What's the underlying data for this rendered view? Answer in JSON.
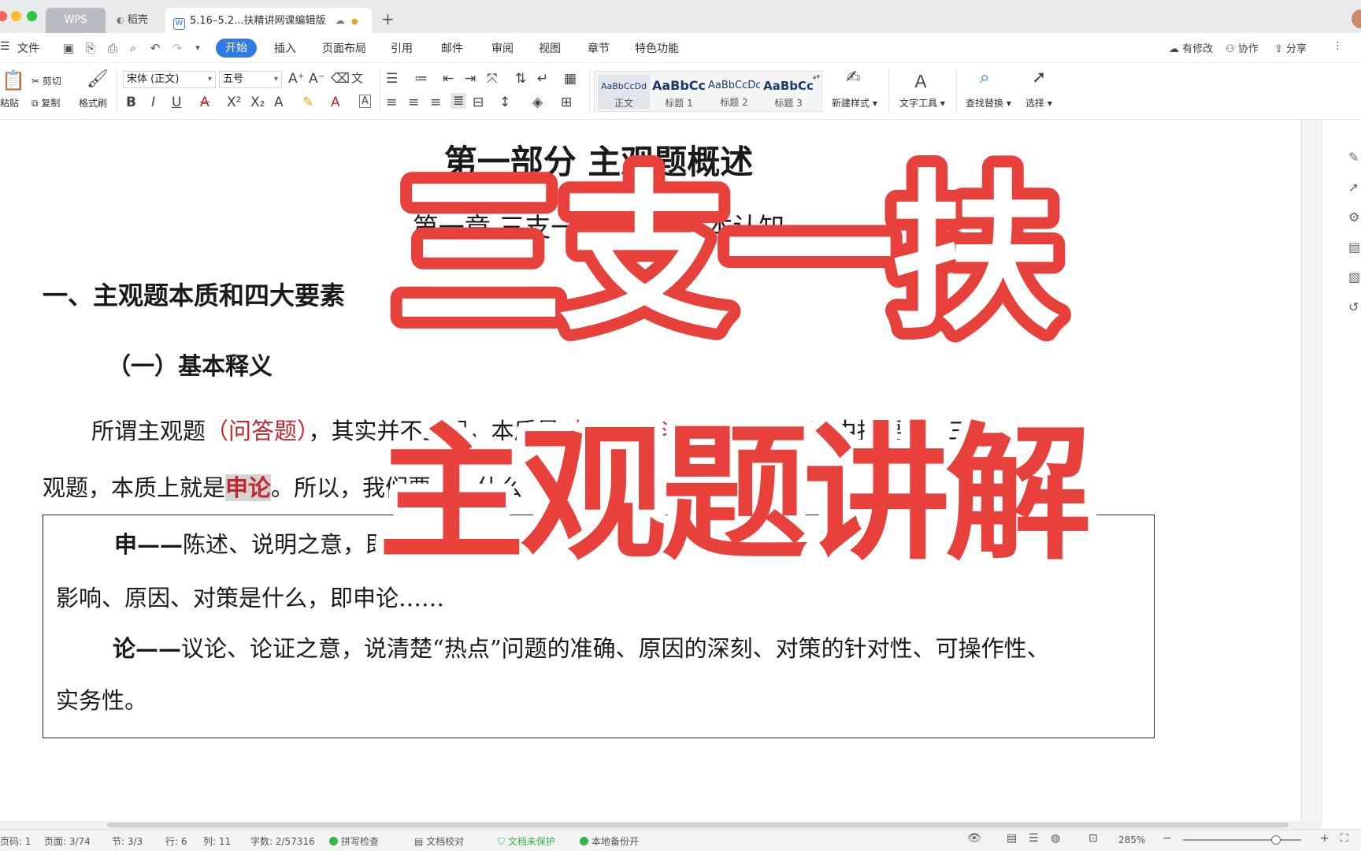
{
  "tabs": {
    "wps": "WPS",
    "daoke": "稻壳",
    "document": "5.16–5.2...扶精讲网课编辑版"
  },
  "menu": {
    "file": "文件",
    "items": [
      "开始",
      "插入",
      "页面布局",
      "引用",
      "邮件",
      "审阅",
      "视图",
      "章节",
      "特色功能"
    ],
    "right": {
      "revise": "有修改",
      "collab": "协作",
      "share": "分享"
    }
  },
  "ribbon": {
    "cut": "剪切",
    "copy": "复制",
    "paste": "粘贴",
    "format_painter": "格式刷",
    "font_name": "宋体 (正文)",
    "font_size": "五号",
    "styles": [
      {
        "sample": "AaBbCcDd",
        "label": "正文"
      },
      {
        "sample": "AaBbCc",
        "label": "标题 1"
      },
      {
        "sample": "AaBbCcDc",
        "label": "标题 2"
      },
      {
        "sample": "AaBbCc",
        "label": "标题 3"
      }
    ],
    "new_style": "新建样式",
    "text_tools": "文字工具",
    "find_replace": "查找替换",
    "select": "选择"
  },
  "document": {
    "part_title": "第一部分  主观题概述",
    "chapter_title": "第一章  三支一扶主观题基本认知",
    "section": "一、主观题本质和四大要素",
    "subsection": "（一）基本释义",
    "p1": {
      "a": "所谓主观题",
      "b": "（问答题）",
      "c": "，其实并不主观，本质是",
      "d": "对客观材料的描述",
      "e": "，从材料中找要点，三支一扶主"
    },
    "p2": {
      "a": "观题，本质上就是",
      "b": "申论",
      "c": "。所以，我们要……什么"
    },
    "box": {
      "l1_bold": "申——",
      "l1": "陈述、说明之意，即不……影响……",
      "l2": "影响、原因、对策是什么，即申论……",
      "l3_bold": "论——",
      "l3": "议论、论证之意，说清楚“热点”问题的准确、原因的深刻、对策的针对性、可操作性、",
      "l4": "实务性。"
    }
  },
  "overlay": {
    "line1": "三支一扶",
    "line2": "主观题讲解"
  },
  "status": {
    "page_num": "页码: 1",
    "page": "页面: 3/74",
    "section": "节: 3/3",
    "row": "行: 6",
    "col": "列: 11",
    "words": "字数: 2/57316",
    "spell": "拼写检查",
    "proof": "文档校对",
    "protect": "文档未保护",
    "backup": "本地备份开",
    "zoom": "285%"
  },
  "colors": {
    "accent": "#2f7be3",
    "overlay_red": "#e8413c",
    "doc_red": "#c1272d"
  }
}
